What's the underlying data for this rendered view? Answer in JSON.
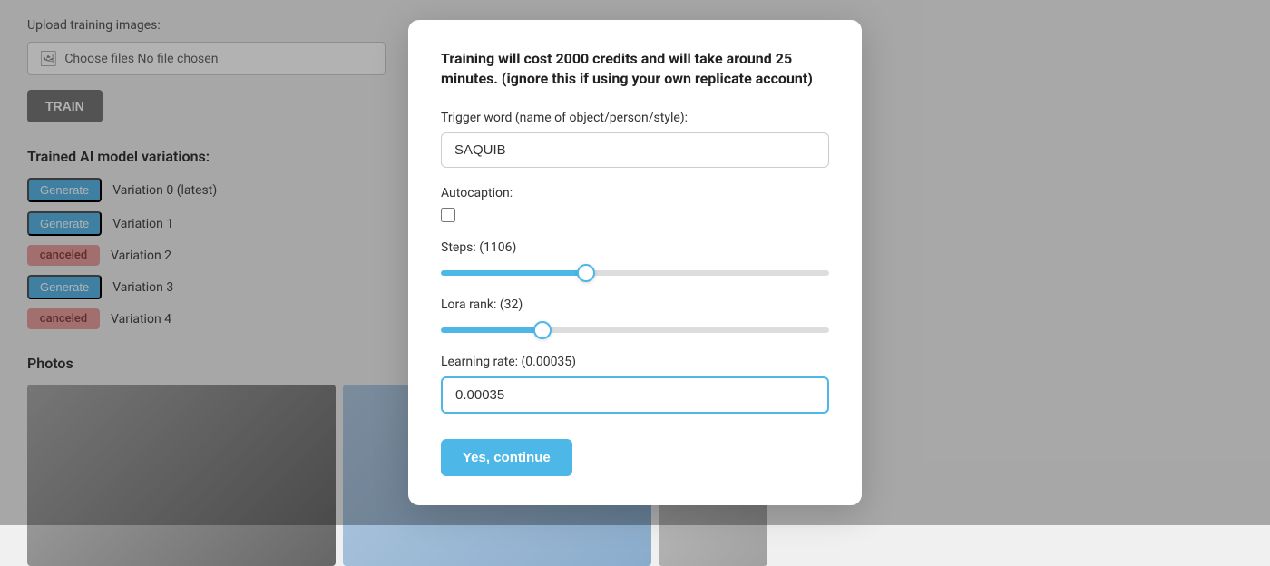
{
  "page": {
    "background": {
      "upload_label": "Upload training images:",
      "file_input_text": "Choose files",
      "file_no_file": "No file chosen",
      "train_button": "TRAIN",
      "variations_title": "Trained AI model variations:",
      "variations": [
        {
          "badge": "Generate",
          "badge_type": "blue",
          "label": "Variation 0 (latest)"
        },
        {
          "badge": "Generate",
          "badge_type": "blue",
          "label": "Variation 1"
        },
        {
          "badge": "canceled",
          "badge_type": "pink",
          "label": "Variation 2"
        },
        {
          "badge": "Generate",
          "badge_type": "blue",
          "label": "Variation 3"
        },
        {
          "badge": "canceled",
          "badge_type": "pink",
          "label": "Variation 4"
        }
      ],
      "photos_title": "Photos"
    },
    "modal": {
      "header": "Training will cost 2000 credits and will take around 25 minutes. (ignore this if using your own replicate account)",
      "trigger_label": "Trigger word (name of object/person/style):",
      "trigger_value": "SAQUIB",
      "autocaption_label": "Autocaption:",
      "autocaption_checked": false,
      "steps_label": "Steps: (1106)",
      "steps_value": 1106,
      "steps_min": 0,
      "steps_max": 3000,
      "lora_rank_label": "Lora rank: (32)",
      "lora_rank_value": 32,
      "lora_rank_min": 0,
      "lora_rank_max": 128,
      "learning_rate_label": "Learning rate: (0.00035)",
      "learning_rate_value": "0.00035",
      "continue_button": "Yes, continue"
    }
  }
}
